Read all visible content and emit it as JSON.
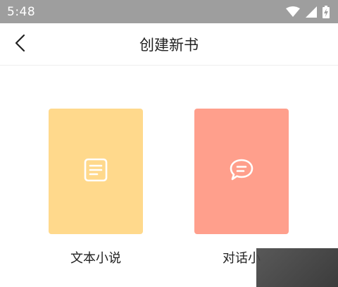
{
  "status_bar": {
    "time": "5:48",
    "icons": [
      "wifi-icon",
      "signal-icon",
      "battery-charging-icon"
    ]
  },
  "app_bar": {
    "title": "创建新书",
    "back_icon": "chevron-left-icon"
  },
  "options": [
    {
      "label": "文本小说",
      "icon": "document-icon",
      "color": "#ffd98c"
    },
    {
      "label": "对话小",
      "icon": "chat-bubble-icon",
      "color": "#ff9f8c"
    }
  ],
  "colors": {
    "status_bar": "#9e9e9e",
    "text": "#222222"
  }
}
